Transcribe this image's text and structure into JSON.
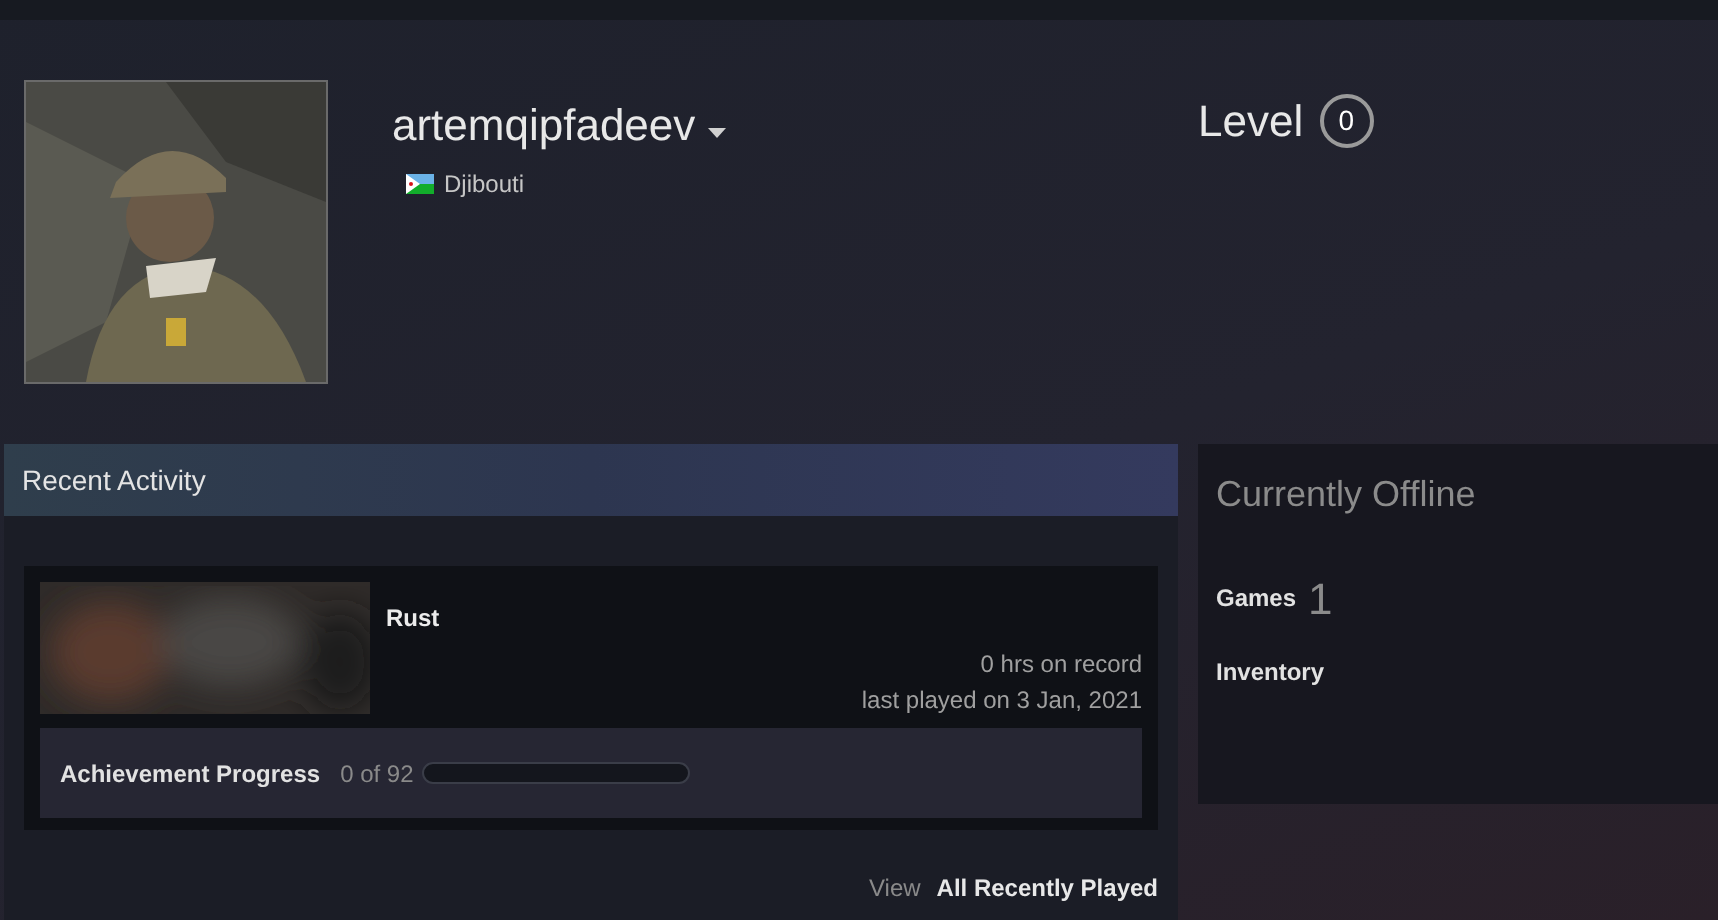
{
  "profile": {
    "name": "artemqipfadeev",
    "country": "Djibouti",
    "level_label": "Level",
    "level": "0"
  },
  "recent_activity": {
    "title": "Recent Activity",
    "games": [
      {
        "name": "Rust",
        "hours": "0 hrs on record",
        "last_played": "last played on 3 Jan, 2021",
        "achievement_label": "Achievement Progress",
        "achievement_count": "0 of 92",
        "level": 0
      }
    ],
    "view_label": "View",
    "view_link": "All Recently Played"
  },
  "sidebar": {
    "status": "Currently Offline",
    "games_label": "Games",
    "games_count": "1",
    "inventory_label": "Inventory"
  }
}
